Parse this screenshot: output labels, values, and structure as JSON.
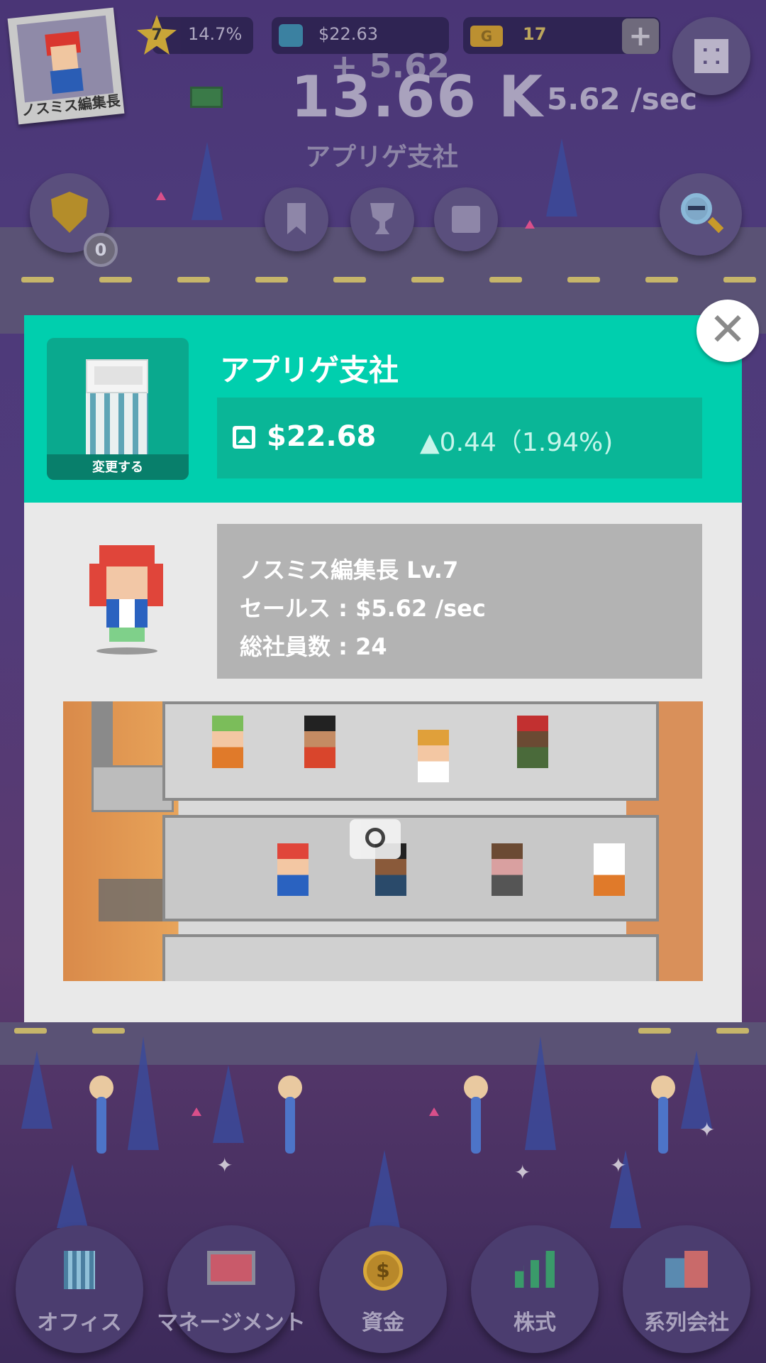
{
  "hud": {
    "profile_name": "ノスミス編集長",
    "level": "7",
    "level_progress": "14.7%",
    "stock_price": "$22.63",
    "gold_icon_letter": "G",
    "gold": "17",
    "add_label": "+",
    "money_gain": "+ 5.62",
    "money_total": "13.66 K",
    "money_per_sec": "5.62 /sec",
    "branch_name": "アプリゲ支社",
    "badge_count": "0"
  },
  "modal": {
    "title": "アプリゲ支社",
    "change_label": "変更する",
    "price": "$22.68",
    "delta": "▲0.44（1.94%)",
    "ceo_line": "ノスミス編集長 Lv.7",
    "sales_line": "セールス : $5.62 /sec",
    "staff_line": "総社員数 : 24",
    "close_label": "✕"
  },
  "nav": [
    {
      "label": "オフィス",
      "icon": "office-icon"
    },
    {
      "label": "マネージメント",
      "icon": "monitor-icon"
    },
    {
      "label": "資金",
      "icon": "coin-icon"
    },
    {
      "label": "株式",
      "icon": "chart-icon"
    },
    {
      "label": "系列会社",
      "icon": "buildings-icon"
    }
  ],
  "colors": {
    "accent": "#00cfae",
    "accent_dark": "#0ab697",
    "background": "#4a3576"
  }
}
